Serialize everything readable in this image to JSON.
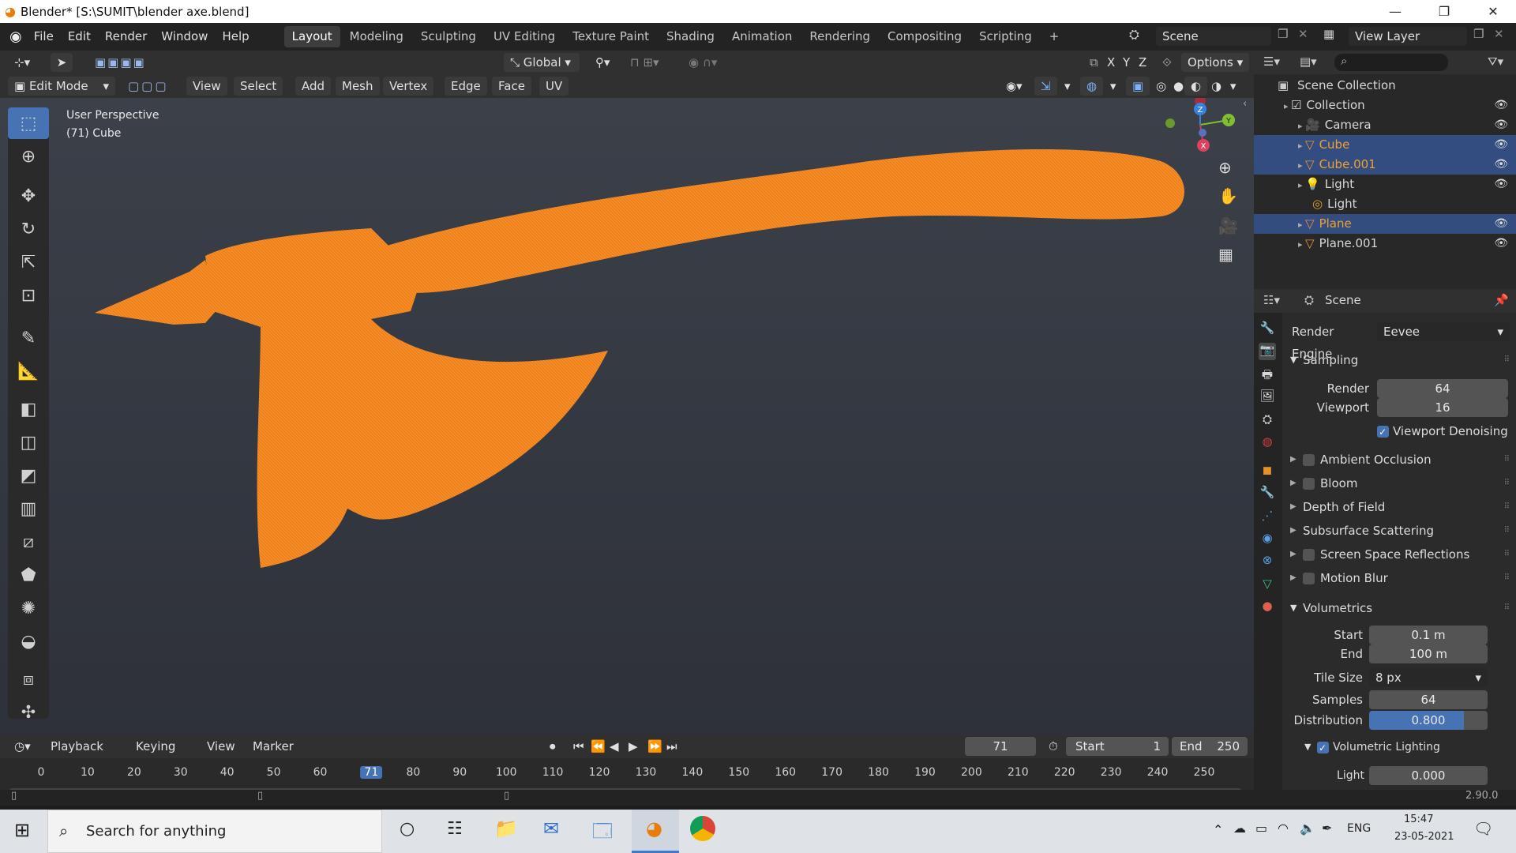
{
  "window": {
    "title": "Blender* [S:\\SUMIT\\blender axe.blend]",
    "minimize": "—",
    "maximize": "❐",
    "close": "✕"
  },
  "menu": [
    "File",
    "Edit",
    "Render",
    "Window",
    "Help"
  ],
  "workspaces": [
    {
      "label": "Layout",
      "active": true
    },
    {
      "label": "Modeling"
    },
    {
      "label": "Sculpting"
    },
    {
      "label": "UV Editing"
    },
    {
      "label": "Texture Paint"
    },
    {
      "label": "Shading"
    },
    {
      "label": "Animation"
    },
    {
      "label": "Rendering"
    },
    {
      "label": "Compositing"
    },
    {
      "label": "Scripting"
    }
  ],
  "add_workspace": "+",
  "scene_field": "Scene",
  "view_layer_field": "View Layer",
  "viewport": {
    "transform_orientation": "Global",
    "options_label": "Options",
    "axes": [
      "X",
      "Y",
      "Z"
    ],
    "mode": "Edit Mode",
    "menus": [
      "View",
      "Select",
      "Add",
      "Mesh",
      "Vertex",
      "Edge",
      "Face",
      "UV"
    ],
    "info_line1": "User Perspective",
    "info_line2": "(71) Cube",
    "gizmo_labels": {
      "x": "X",
      "y": "Y",
      "z": "Z"
    },
    "mesh_color": "#f08018"
  },
  "outliner": {
    "search_placeholder": "",
    "root": "Scene Collection",
    "items": [
      {
        "label": "Collection",
        "indent": 1,
        "selected": false
      },
      {
        "label": "Camera",
        "indent": 2,
        "selected": false,
        "color": "#d8d8d8"
      },
      {
        "label": "Cube",
        "indent": 2,
        "selected": true,
        "color": "#f0a030"
      },
      {
        "label": "Cube.001",
        "indent": 2,
        "selected": true,
        "color": "#f0a030"
      },
      {
        "label": "Light",
        "indent": 2,
        "selected": false,
        "color": "#d8d8d8"
      },
      {
        "label": "Light",
        "indent": 3,
        "selected": false,
        "color": "#d8d8d8"
      },
      {
        "label": "Plane",
        "indent": 2,
        "selected": true,
        "color": "#f0a030"
      },
      {
        "label": "Plane.001",
        "indent": 2,
        "selected": false,
        "color": "#d8d8d8"
      }
    ]
  },
  "properties": {
    "context": "Scene",
    "render_engine_label": "Render Engine",
    "render_engine": "Eevee",
    "sampling": {
      "label": "Sampling",
      "render_label": "Render",
      "render": "64",
      "viewport_label": "Viewport",
      "viewport": "16",
      "denoise_label": "Viewport Denoising"
    },
    "panels": [
      "Ambient Occlusion",
      "Bloom",
      "Depth of Field",
      "Subsurface Scattering",
      "Screen Space Reflections",
      "Motion Blur"
    ],
    "volumetrics": {
      "label": "Volumetrics",
      "start_label": "Start",
      "start": "0.1 m",
      "end_label": "End",
      "end": "100 m",
      "tile_label": "Tile Size",
      "tile": "8 px",
      "samples_label": "Samples",
      "samples": "64",
      "distribution_label": "Distribution",
      "distribution": "0.800",
      "distribution_fraction": 0.8,
      "lighting_label": "Volumetric Lighting",
      "clamp_label": "Light Clampi...",
      "clamp": "0.000"
    },
    "version": "2.90.0"
  },
  "timeline": {
    "menus": [
      "Playback",
      "Keying",
      "View",
      "Marker"
    ],
    "current_frame": "71",
    "start_label": "Start",
    "start": "1",
    "end_label": "End",
    "end": "250",
    "ticks": [
      "0",
      "10",
      "20",
      "30",
      "40",
      "50",
      "60",
      "71",
      "80",
      "90",
      "100",
      "110",
      "120",
      "130",
      "140",
      "150",
      "160",
      "170",
      "180",
      "190",
      "200",
      "210",
      "220",
      "230",
      "240",
      "250"
    ]
  },
  "taskbar": {
    "search": "Search for anything",
    "language": "ENG",
    "time": "15:47",
    "date": "23-05-2021"
  }
}
